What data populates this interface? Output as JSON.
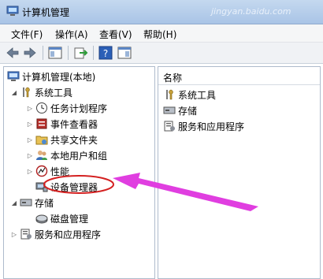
{
  "window": {
    "title": "计算机管理",
    "watermark": "jingyan.baidu.com"
  },
  "menu": {
    "file": "文件(F)",
    "action": "操作(A)",
    "view": "查看(V)",
    "help": "帮助(H)"
  },
  "tree": {
    "root": "计算机管理(本地)",
    "system_tools": "系统工具",
    "task_scheduler": "任务计划程序",
    "event_viewer": "事件查看器",
    "shared_folders": "共享文件夹",
    "local_users": "本地用户和组",
    "performance": "性能",
    "device_manager": "设备管理器",
    "storage": "存储",
    "disk_management": "磁盘管理",
    "services_apps": "服务和应用程序"
  },
  "right": {
    "column_header": "名称",
    "items": [
      "系统工具",
      "存储",
      "服务和应用程序"
    ]
  },
  "colors": {
    "highlight_oval": "#d42020",
    "pointer_arrow": "#e03ee0"
  }
}
